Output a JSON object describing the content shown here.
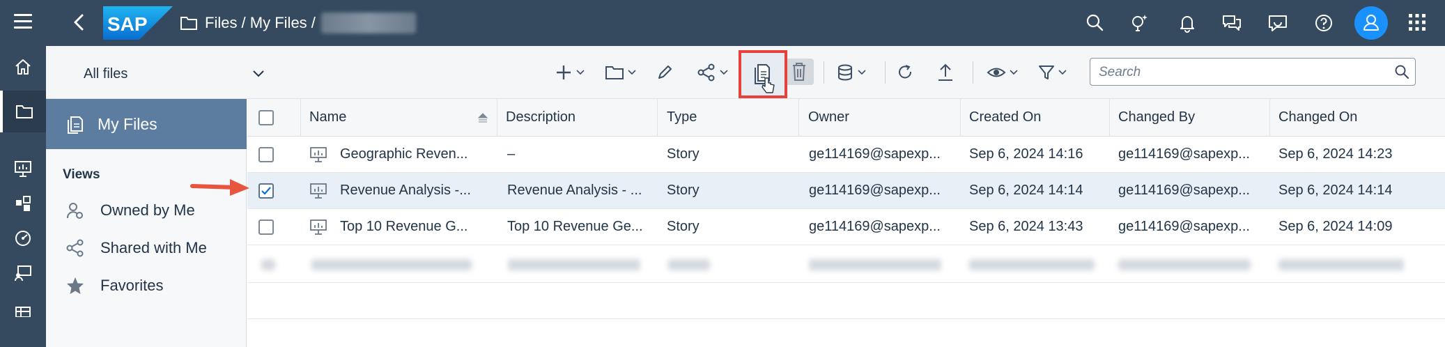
{
  "header": {
    "logo_text": "SAP",
    "breadcrumb": "Files / My Files /",
    "breadcrumb_hidden": ""
  },
  "toolbar": {
    "scope_label": "All files",
    "search_placeholder": "Search"
  },
  "sidebar": {
    "my_files_label": "My Files",
    "views_title": "Views",
    "views": [
      {
        "label": "Owned by Me",
        "icon": "owned-by-me-icon"
      },
      {
        "label": "Shared with Me",
        "icon": "share-icon"
      },
      {
        "label": "Favorites",
        "icon": "star-icon"
      }
    ]
  },
  "table": {
    "columns": [
      "Name",
      "Description",
      "Type",
      "Owner",
      "Created On",
      "Changed By",
      "Changed On"
    ],
    "rows": [
      {
        "name": "Geographic Reven...",
        "description": "–",
        "type": "Story",
        "owner": "ge114169@sapexp...",
        "created_on": "Sep 6, 2024 14:16",
        "changed_by": "ge114169@sapexp...",
        "changed_on": "Sep 6, 2024 14:23",
        "checked": false
      },
      {
        "name": "Revenue Analysis -...",
        "description": "Revenue Analysis - ...",
        "type": "Story",
        "owner": "ge114169@sapexp...",
        "created_on": "Sep 6, 2024 14:14",
        "changed_by": "ge114169@sapexp...",
        "changed_on": "Sep 6, 2024 14:14",
        "checked": true
      },
      {
        "name": "Top 10 Revenue G...",
        "description": "Top 10 Revenue Ge...",
        "type": "Story",
        "owner": "ge114169@sapexp...",
        "created_on": "Sep 6, 2024 13:43",
        "changed_by": "ge114169@sapexp...",
        "changed_on": "Sep 6, 2024 14:09",
        "checked": false
      }
    ]
  },
  "colors": {
    "shell": "#354a5f",
    "selected_nav": "#5d7da0",
    "highlight": "#e8403a",
    "accent": "#1b90ff"
  }
}
